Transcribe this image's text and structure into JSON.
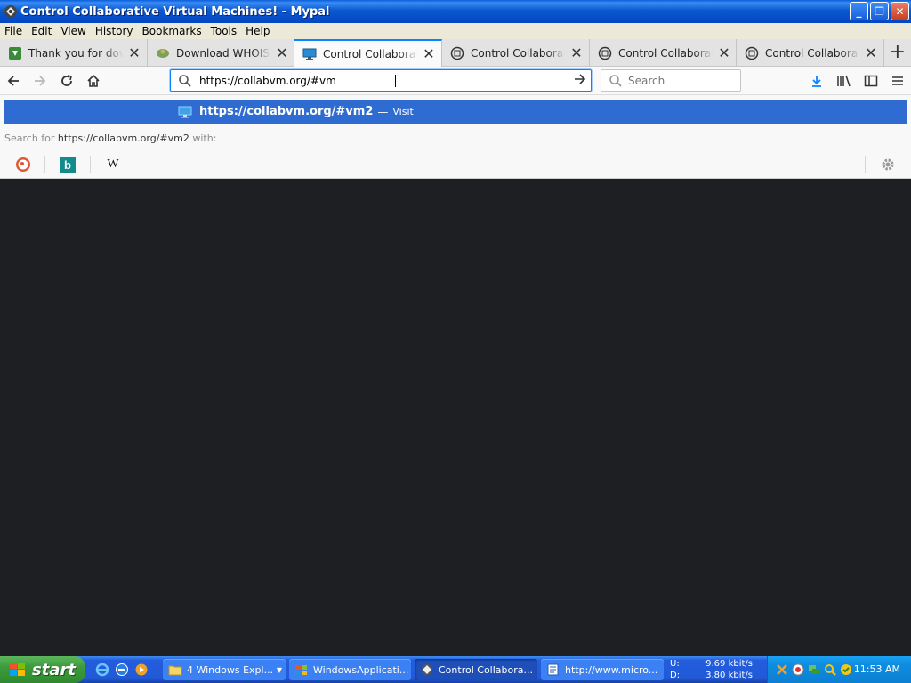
{
  "window": {
    "title": "Control Collaborative Virtual Machines! - Mypal",
    "minimize": "_",
    "maximize": "❐",
    "close": "✕"
  },
  "menu": {
    "items": [
      "File",
      "Edit",
      "View",
      "History",
      "Bookmarks",
      "Tools",
      "Help"
    ]
  },
  "tabs": [
    {
      "label": "Thank you for downloading",
      "icon": "download-favicon",
      "close": "✕"
    },
    {
      "label": "Download WHOIS Tool",
      "icon": "whois-favicon",
      "close": "✕"
    },
    {
      "label": "Control Collaborative Virtual Machines!",
      "icon": "monitor-favicon",
      "close": "✕",
      "active": true
    },
    {
      "label": "Control Collaborative Virtual Machines!",
      "icon": "collabvm-favicon",
      "close": "✕"
    },
    {
      "label": "Control Collaborative Virtual Machines!",
      "icon": "collabvm-favicon",
      "close": "✕"
    },
    {
      "label": "Control Collaborative Virtual Machines!",
      "icon": "collabvm-favicon",
      "close": "✕"
    }
  ],
  "new_tab": "+",
  "navbar": {
    "url": "https://collabvm.org/#vm",
    "search_placeholder": "Search"
  },
  "autocomplete": {
    "suggestion_url": "https://collabvm.org/#vm2",
    "separator": "—",
    "action": "Visit",
    "search_for_prefix": "Search for",
    "search_for_term": "https://collabvm.org/#vm2",
    "search_for_suffix": "with:",
    "engines": [
      "duckduckgo-icon",
      "bing-icon",
      "wikipedia-icon"
    ],
    "wikipedia_glyph": "W",
    "bing_glyph": "b"
  },
  "taskbar": {
    "start_label": "start",
    "items": [
      {
        "label": "4 Windows Expl...",
        "icon": "folder-icon"
      },
      {
        "label": "WindowsApplicati...",
        "icon": "app-icon"
      },
      {
        "label": "Control Collabora...",
        "icon": "mypal-icon",
        "active": true
      },
      {
        "label": "http://www.micro...",
        "icon": "document-icon"
      }
    ],
    "net": {
      "up_label": "U:",
      "down_label": "D:",
      "up_value": "9.69 kbit/s",
      "down_value": "3.80 kbit/s"
    },
    "clock": "11:53 AM"
  },
  "colors": {
    "accent": "#0a84ff",
    "suggestion_bg": "#2f6cd1",
    "page_bg": "#1d1f23"
  }
}
